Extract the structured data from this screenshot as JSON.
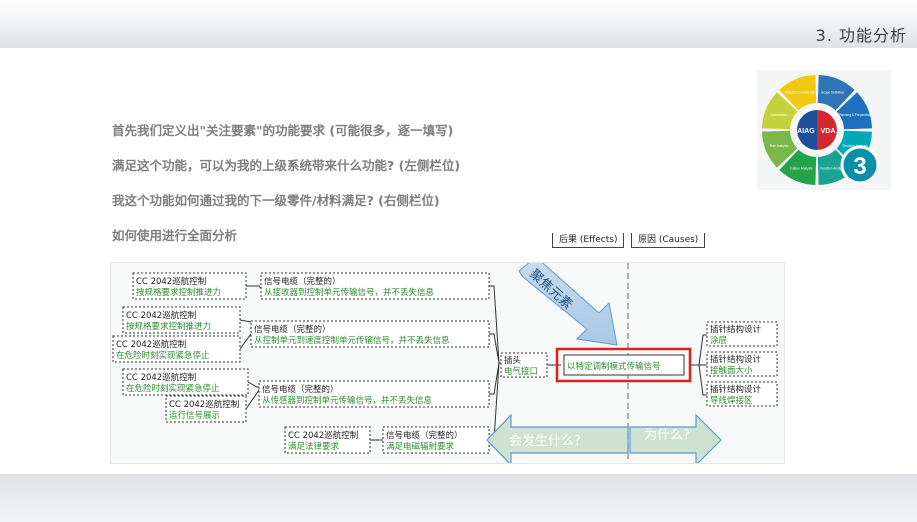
{
  "header": {
    "title": "3. 功能分析"
  },
  "questions": [
    "首先我们定义出\"关注要素\"的功能要求 (可能很多，逐一填写)",
    "满足这个功能，可以为我的上级系统带来什么功能? (左侧栏位)",
    "我这个功能如何通过我的下一级零件/材料满足? (右侧栏位)",
    "如何使用进行全面分析"
  ],
  "columns": {
    "effects": "后果 (Effects)",
    "causes": "原因 (Causes)"
  },
  "logo": {
    "center_left": "AIAG",
    "center_right": "VDA",
    "number": "3",
    "segments": [
      "Scope Definition",
      "Planning & Preparation",
      "Structure Analysis",
      "Function Analysis",
      "Failure Analysis",
      "Risk Analysis",
      "Optimization",
      "Results Documentation"
    ],
    "colors": [
      "#2e75b6",
      "#1f6fbf",
      "#00a9b5",
      "#19a392",
      "#23a34a",
      "#7ab648",
      "#c3d23a",
      "#f2c811"
    ]
  },
  "left_items": [
    {
      "title": "CC 2042巡航控制",
      "desc": "按规格要求控制推进力"
    },
    {
      "title": "CC 2042巡航控制",
      "desc": "按规格要求控制推进力"
    },
    {
      "title": "CC 2042巡航控制",
      "desc": "在危险时刻实现紧急停止"
    },
    {
      "title": "CC 2042巡航控制",
      "desc": "在危险时刻实现紧急停止"
    },
    {
      "title": "CC 2042巡航控制",
      "desc": "运行信号展示"
    },
    {
      "title": "CC 2042巡航控制",
      "desc": "满足法律要求"
    }
  ],
  "mid_items": [
    {
      "title": "信号电缆（完整的）",
      "desc": "从接收器到控制单元传输信号，并不丢失信息"
    },
    {
      "title": "信号电缆（完整的）",
      "desc": "从控制单元到速度控制单元传输信号，并不丢失信息"
    },
    {
      "title": "信号电缆（完整的）",
      "desc": "从传感器到控制单元传输信号，并不丢失信息"
    },
    {
      "title": "信号电缆（完整的）",
      "desc": "满足电磁辐射要求"
    }
  ],
  "focus": {
    "title": "插头",
    "desc": "电气接口",
    "function": "以特定调制模式传输信号"
  },
  "right_items": [
    {
      "title": "插针结构设计",
      "desc": "涂层"
    },
    {
      "title": "插针结构设计",
      "desc": "接触面大小"
    },
    {
      "title": "插针结构设计",
      "desc": "导线焊接区"
    }
  ],
  "callouts": {
    "focus_arrow": "聚焦元素",
    "what_happens": "会发生什么?",
    "why": "为什么?"
  }
}
